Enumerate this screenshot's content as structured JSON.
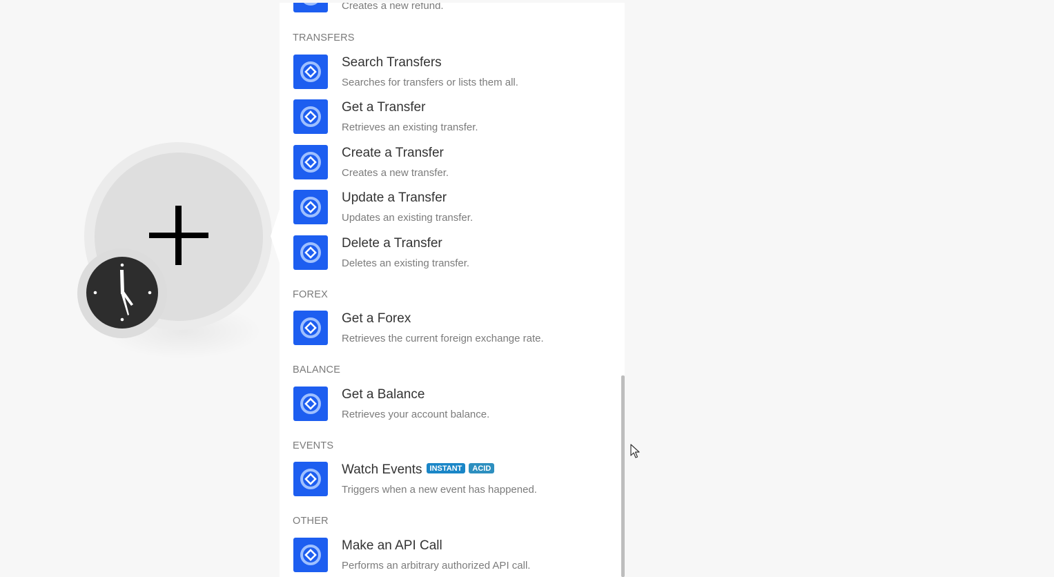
{
  "colors": {
    "app_icon_bg": "#1d5ef0",
    "badge_instant": "#1a86c7",
    "badge_acid": "#2d8fbf",
    "canvas_bg": "#f7f7f7"
  },
  "module": {
    "add_icon": "plus-icon",
    "trigger_icon": "clock-icon"
  },
  "panel": {
    "partial_item": {
      "description": "Creates a new refund."
    },
    "sections": [
      {
        "header": "TRANSFERS",
        "items": [
          {
            "title": "Search Transfers",
            "description": "Searches for transfers or lists them all."
          },
          {
            "title": "Get a Transfer",
            "description": "Retrieves an existing transfer."
          },
          {
            "title": "Create a Transfer",
            "description": "Creates a new transfer."
          },
          {
            "title": "Update a Transfer",
            "description": "Updates an existing transfer."
          },
          {
            "title": "Delete a Transfer",
            "description": "Deletes an existing transfer."
          }
        ]
      },
      {
        "header": "FOREX",
        "items": [
          {
            "title": "Get a Forex",
            "description": "Retrieves the current foreign exchange rate."
          }
        ]
      },
      {
        "header": "BALANCE",
        "items": [
          {
            "title": "Get a Balance",
            "description": "Retrieves your account balance."
          }
        ]
      },
      {
        "header": "EVENTS",
        "items": [
          {
            "title": "Watch Events",
            "description": "Triggers when a new event has happened.",
            "badges": [
              "INSTANT",
              "ACID"
            ]
          }
        ]
      },
      {
        "header": "OTHER",
        "items": [
          {
            "title": "Make an API Call",
            "description": "Performs an arbitrary authorized API call."
          }
        ]
      }
    ]
  }
}
